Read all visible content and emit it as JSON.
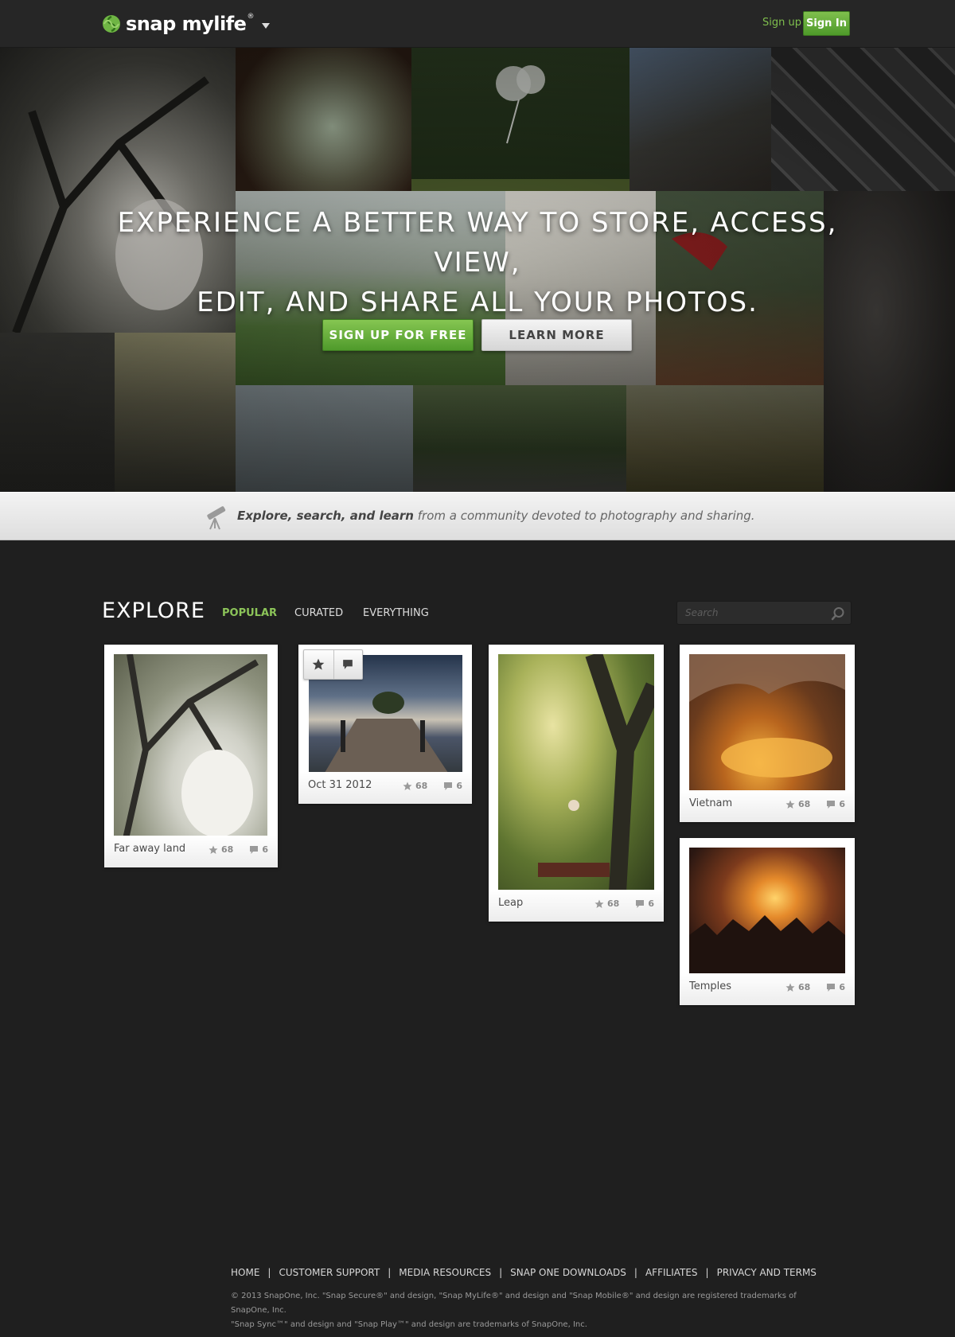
{
  "header": {
    "logo_text": "snap mylife",
    "logo_mark": "®",
    "signup_label": "Sign up",
    "signin_label": "Sign In"
  },
  "hero": {
    "headline_line1": "EXPERIENCE A BETTER WAY TO STORE, ACCESS, VIEW,",
    "headline_line2": "EDIT, AND SHARE ALL YOUR PHOTOS.",
    "primary_button": "SIGN UP FOR FREE",
    "secondary_button": "LEARN MORE"
  },
  "tagline": {
    "bold": "Explore, search, and learn",
    "rest": "from a community devoted to photography and sharing."
  },
  "explore": {
    "title": "EXPLORE",
    "tabs": [
      "POPULAR",
      "CURATED",
      "EVERYTHING"
    ],
    "active_tab": "POPULAR",
    "search_placeholder": "Search"
  },
  "cards": [
    {
      "title": "Far away land",
      "likes": "68",
      "comments": "6"
    },
    {
      "title": "Oct 31 2012",
      "likes": "68",
      "comments": "6"
    },
    {
      "title": "Leap",
      "likes": "68",
      "comments": "6"
    },
    {
      "title": "Vietnam",
      "likes": "68",
      "comments": "6"
    },
    {
      "title": "Temples",
      "likes": "68",
      "comments": "6"
    }
  ],
  "footer": {
    "links": [
      "HOME",
      "CUSTOMER SUPPORT",
      "MEDIA RESOURCES",
      "SNAP ONE DOWNLOADS",
      "AFFILIATES",
      "PRIVACY AND TERMS"
    ],
    "separator": "|",
    "legal_line1": "© 2013 SnapOne, Inc.  \"Snap Secure®\" and design, \"Snap MyLife®\" and design and \"Snap Mobile®\" and design are registered trademarks of SnapOne, Inc.",
    "legal_line2": "\"Snap Sync™\" and design and \"Snap Play™\" and design are trademarks of SnapOne, Inc."
  },
  "colors": {
    "accent_green": "#7fbf4d",
    "page_background": "#1f1f1f",
    "header_background": "#262626"
  }
}
